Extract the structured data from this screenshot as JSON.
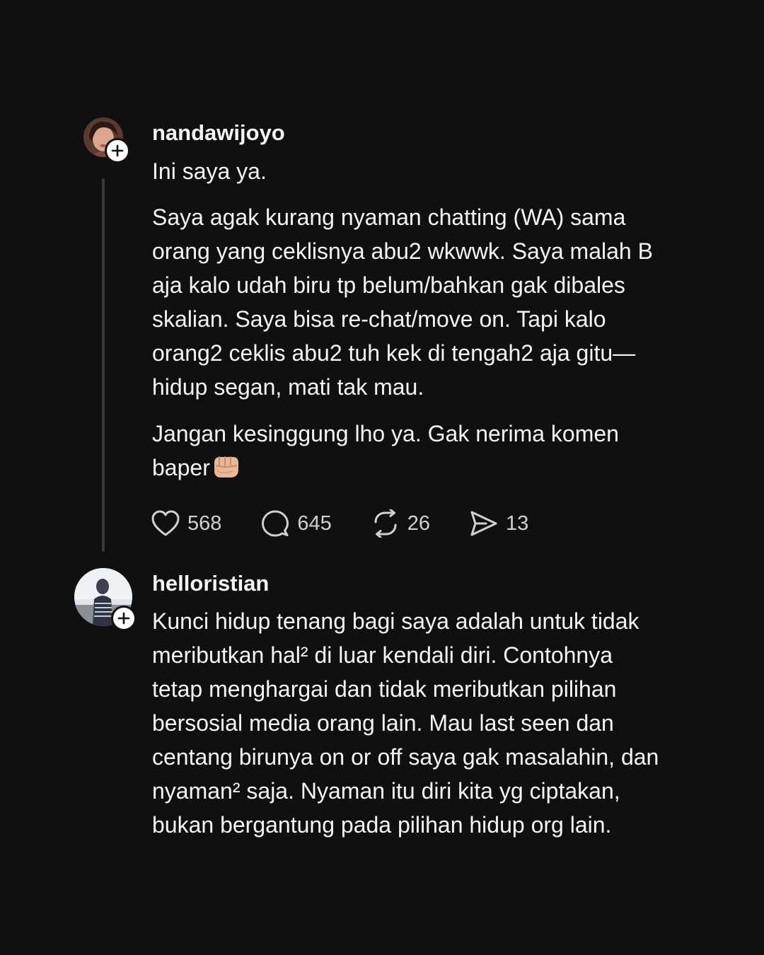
{
  "posts": [
    {
      "username": "nandawijoyo",
      "paragraphs": [
        "Ini saya ya.",
        "Saya agak kurang nyaman chatting (WA) sama\norang yang ceklisnya abu2 wkwwk. Saya malah B\naja kalo udah biru tp belum/bahkan gak dibales\nskalian. Saya bisa re-chat/move on. Tapi kalo\norang2 ceklis abu2 tuh kek di tengah2 aja gitu—\nhidup segan, mati tak mau.",
        "Jangan kesinggung lho ya. Gak nerima komen\nbaper"
      ],
      "emoji": "oncoming-fist-emoji",
      "actions": {
        "likes": "568",
        "comments": "645",
        "reposts": "26",
        "shares": "13"
      }
    },
    {
      "username": "helloristian",
      "paragraphs": [
        "Kunci hidup tenang bagi saya adalah untuk tidak\nmeributkan hal² di luar kendali diri. Contohnya\ntetap menghargai dan tidak meributkan pilihan\nbersosial media orang lain. Mau last seen dan\ncentang birunya on or off saya gak masalahin, dan\nnyaman² saja. Nyaman itu diri kita yg ciptakan,\nbukan bergantung pada pilihan hidup org lain."
      ]
    }
  ],
  "icons": {
    "like": "heart-icon",
    "comment": "comment-bubble-icon",
    "repost": "repost-icon",
    "share": "send-icon",
    "follow": "plus-icon"
  },
  "colors": {
    "background": "#101010",
    "text": "#f3f5f7",
    "secondary": "#d0d0d0",
    "thread_line": "#3a3a3a"
  }
}
